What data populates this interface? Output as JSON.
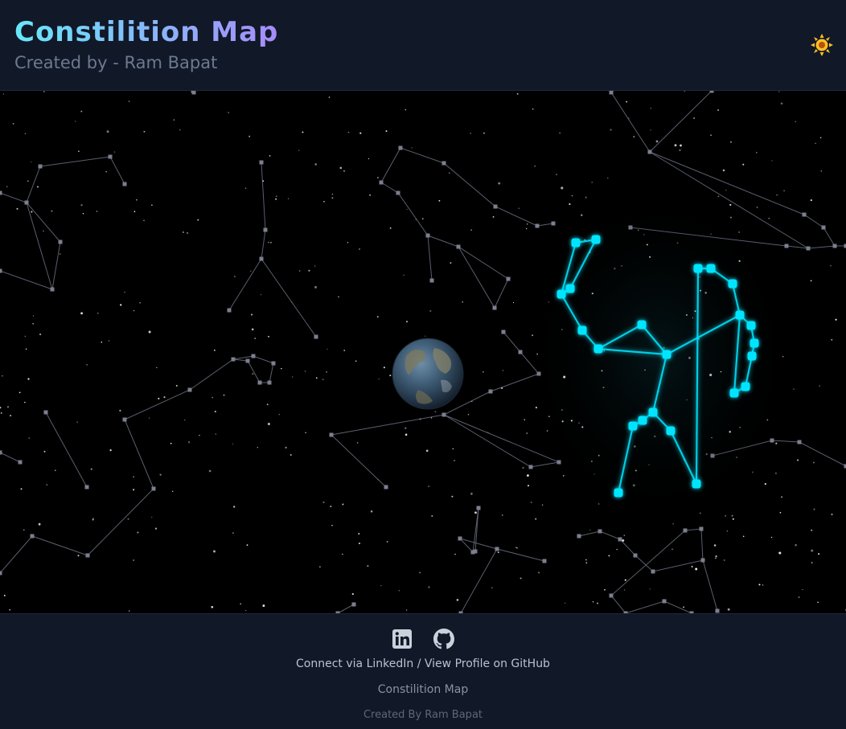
{
  "header": {
    "title": "Constilition Map",
    "subtitle": "Created by - Ram Bapat",
    "theme_icon": "sun-icon"
  },
  "sky": {
    "background": "#000000",
    "dim_line_color": "#6b6f80",
    "highlight_color": "#00e5ff",
    "planet_icon": "earth-globe"
  },
  "footer": {
    "linkedin_icon": "linkedin-icon",
    "github_icon": "github-icon",
    "connect_prefix": "Connect via ",
    "linkedin_label": "LinkedIn",
    "separator": " / ",
    "github_label": "View Profile on GitHub",
    "title": "Constilition Map",
    "credit": "Created By Ram Bapat"
  },
  "colors": {
    "title_gradient_start": "#67e8f9",
    "title_gradient_end": "#a78bfa",
    "sun": "#fbbf24",
    "panel_bg": "#111827"
  }
}
